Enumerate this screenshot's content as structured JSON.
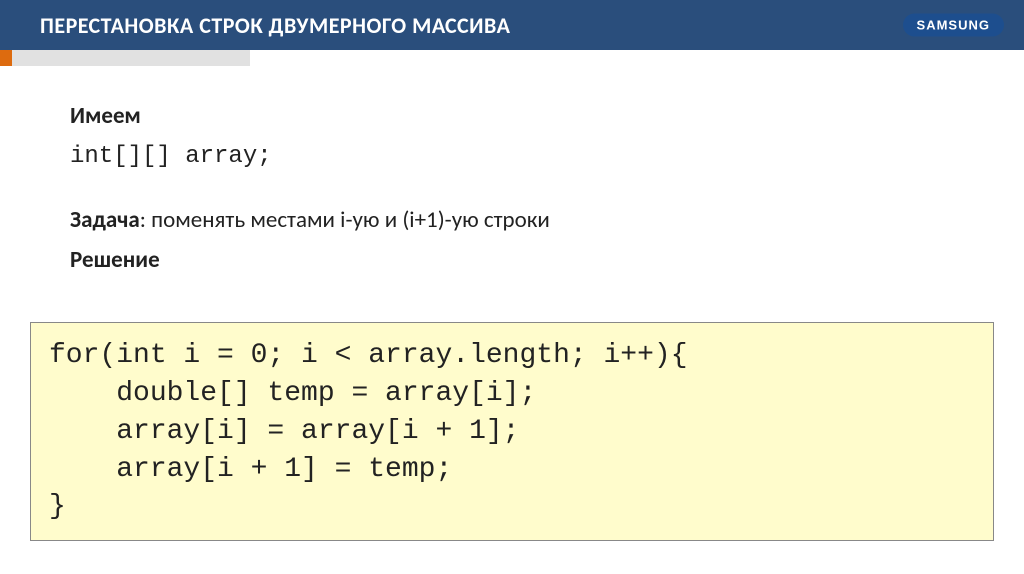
{
  "header": {
    "title": "ПЕРЕСТАНОВКА СТРОК ДВУМЕРНОГО МАССИВА",
    "logo": "SAMSUNG"
  },
  "content": {
    "intro_label": "Имеем",
    "declaration": "int[][] array;",
    "task_label": "Задача",
    "task_text": ": поменять местами i-ую и (i+1)-ую строки",
    "solution_label": "Решение"
  },
  "code": "for(int i = 0; i < array.length; i++){\n    double[] temp = array[i];\n    array[i] = array[i + 1];\n    array[i + 1] = temp;\n}"
}
